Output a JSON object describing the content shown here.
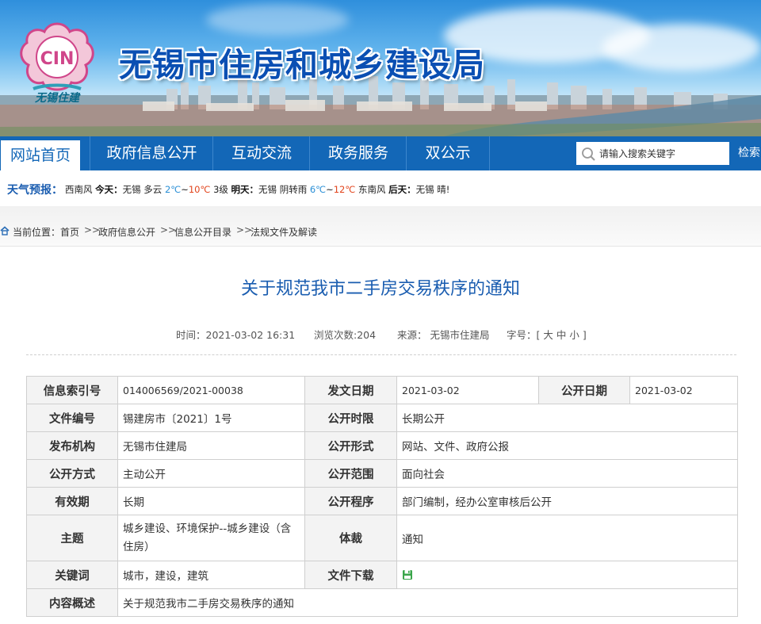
{
  "header": {
    "logo_text": "CIN",
    "logo_subtitle": "无锡住建",
    "site_title": "无锡市住房和城乡建设局"
  },
  "nav": {
    "items": [
      {
        "label": "网站首页",
        "active": true
      },
      {
        "label": "政府信息公开",
        "active": false
      },
      {
        "label": "互动交流",
        "active": false
      },
      {
        "label": "政务服务",
        "active": false
      },
      {
        "label": "双公示",
        "active": false
      }
    ],
    "search_placeholder": "请输入搜索关键字",
    "search_button": "检索"
  },
  "weather": {
    "label": "天气预报：",
    "lead": "西南风",
    "today_label": "今天：",
    "today_desc": "无锡 多云",
    "today_low": "2℃",
    "today_sep": "~",
    "today_high": "10℃",
    "today_wind": "3级",
    "tomorrow_label": "明天：",
    "tomorrow_desc": "无锡 阴转雨",
    "tomorrow_low": "6℃",
    "tomorrow_sep": "~",
    "tomorrow_high": "12℃",
    "tomorrow_wind": "东南风",
    "after_label": "后天：",
    "after_desc": "无锡 晴!"
  },
  "breadcrumb": {
    "prefix": "当前位置：",
    "items": [
      "首页",
      "政府信息公开",
      "信息公开目录",
      "法规文件及解读"
    ],
    "separator": ">>"
  },
  "article": {
    "title": "关于规范我市二手房交易秩序的通知",
    "time": "时间：2021-03-02 16:31",
    "views": "浏览次数:204",
    "source": "来源： 无锡市住建局",
    "font_label": "字号：[",
    "font_large": "大",
    "font_medium": "中",
    "font_small": "小",
    "font_close": "]"
  },
  "info": {
    "index_label": "信息索引号",
    "index_value": "014006569/2021-00038",
    "date_label": "发文日期",
    "date_value": "2021-03-02",
    "pubdate_label": "公开日期",
    "pubdate_value": "2021-03-02",
    "docno_label": "文件编号",
    "docno_value": "锡建房市〔2021〕1号",
    "period_label": "公开时限",
    "period_value": "长期公开",
    "org_label": "发布机构",
    "org_value": "无锡市住建局",
    "form_label": "公开形式",
    "form_value": "网站、文件、政府公报",
    "mode_label": "公开方式",
    "mode_value": "主动公开",
    "scope_label": "公开范围",
    "scope_value": "面向社会",
    "valid_label": "有效期",
    "valid_value": "长期",
    "proc_label": "公开程序",
    "proc_value": "部门编制，经办公室审核后公开",
    "topic_label": "主题",
    "topic_value": "城乡建设、环境保护--城乡建设（含住房）",
    "genre_label": "体裁",
    "genre_value": "通知",
    "kw_label": "关键词",
    "kw_value": "城市，建设，建筑",
    "dl_label": "文件下载",
    "summary_label": "内容概述",
    "summary_value": "关于规范我市二手房交易秩序的通知"
  },
  "colors": {
    "nav_blue": "#1367b7",
    "title_blue": "#1a5db0",
    "temp_low": "#2a8fd6",
    "temp_high": "#e2441c"
  }
}
